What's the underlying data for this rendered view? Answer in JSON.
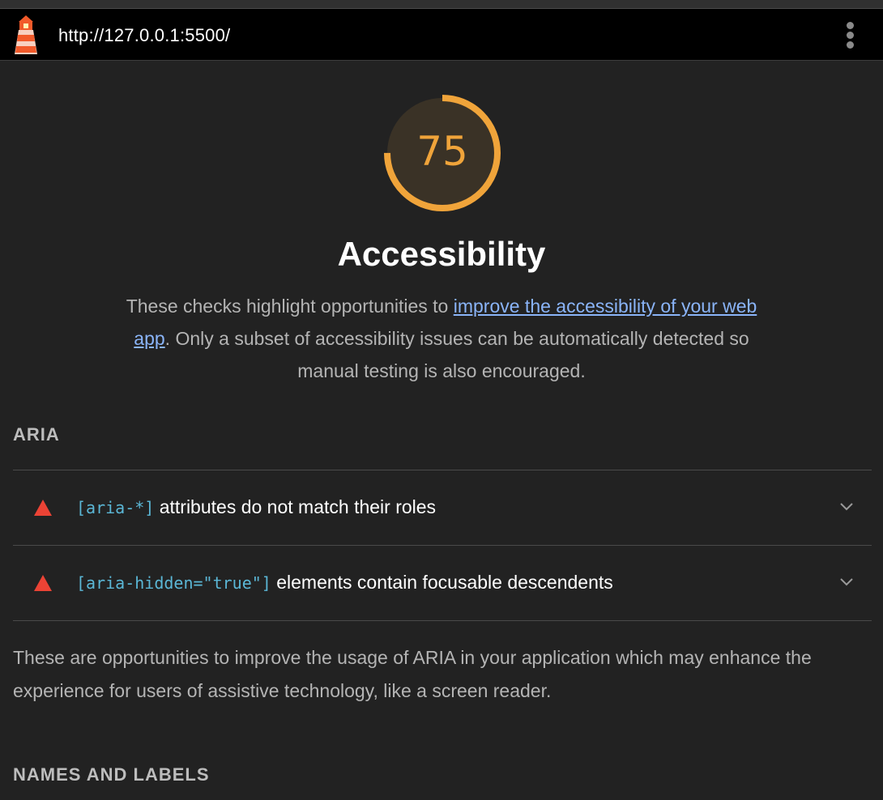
{
  "header": {
    "url": "http://127.0.0.1:5500/",
    "logo_icon": "lighthouse-icon",
    "menu_icon": "more-vertical-icon"
  },
  "score": {
    "value": "75",
    "fraction": 0.75,
    "color": "#f0a43a"
  },
  "category": {
    "title": "Accessibility",
    "description_before": "These checks highlight opportunities to ",
    "description_link": "improve the accessibility of your web app",
    "description_after": ". Only a subset of accessibility issues can be automatically detected so manual testing is also encouraged."
  },
  "groups": [
    {
      "title": "ARIA",
      "audits": [
        {
          "code": "[aria-*]",
          "text": " attributes do not match their roles",
          "status_icon": "fail-triangle-icon",
          "status_color": "#eb4335"
        },
        {
          "code": "[aria-hidden=\"true\"]",
          "text": " elements contain focusable descendents",
          "status_icon": "fail-triangle-icon",
          "status_color": "#eb4335"
        }
      ],
      "description": "These are opportunities to improve the usage of ARIA in your application which may enhance the experience for users of assistive technology, like a screen reader."
    },
    {
      "title": "NAMES AND LABELS"
    }
  ]
}
